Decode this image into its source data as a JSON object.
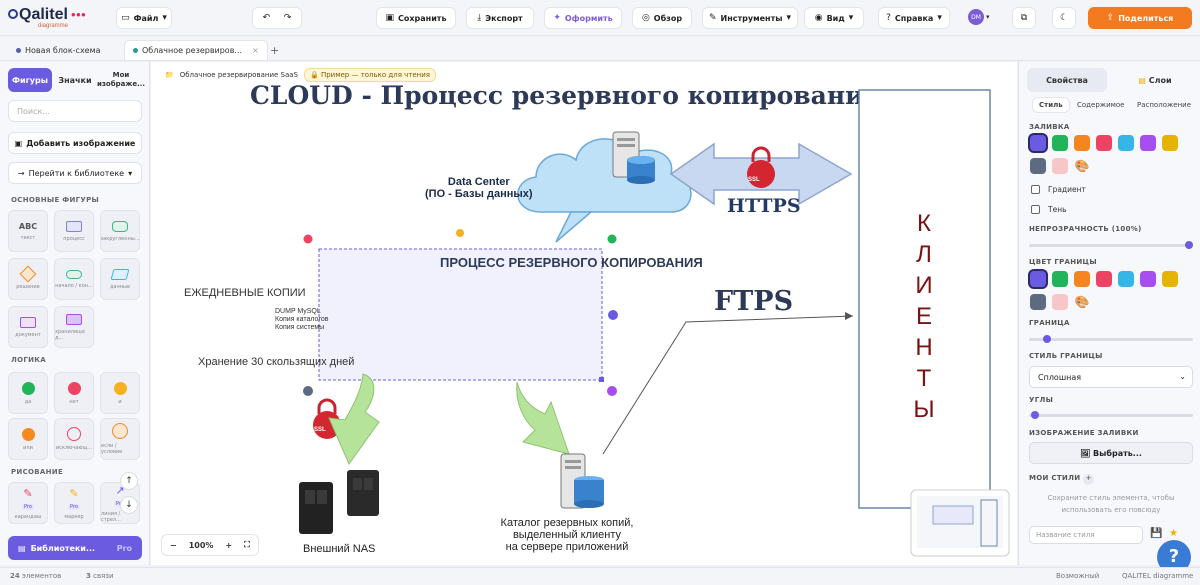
{
  "app": {
    "brand": "Qalitel",
    "brand_sub": "diagramme"
  },
  "toolbar": {
    "file": "Файл",
    "save": "Сохранить",
    "export": "Экспорт",
    "format": "Оформить",
    "overview": "Обзор",
    "tools": "Инструменты",
    "view": "Вид",
    "help": "Справка",
    "share": "Поделиться",
    "user_initials": "DM"
  },
  "tabs": [
    {
      "label": "Новая блок-схема"
    },
    {
      "label": "Облачное резервиров..."
    }
  ],
  "left": {
    "tabs": [
      "Фигуры",
      "Значки",
      "Мои изображе..."
    ],
    "search_placeholder": "Поиск...",
    "add_image": "Добавить изображение",
    "goto_library": "Перейти к библиотеке",
    "sections": {
      "basic": "ОСНОВНЫЕ ФИГУРЫ",
      "logic": "ЛОГИКА",
      "draw": "РИСОВАНИЕ"
    },
    "basic_shapes": [
      "текст",
      "процесс",
      "закругленны...",
      "решение",
      "начало / кон...",
      "данные",
      "документ",
      "хранилище д..."
    ],
    "logic_shapes": [
      "да",
      "нет",
      "и",
      "или",
      "исключающ...",
      "если / условие"
    ],
    "draw_shapes": [
      "карандаш",
      "маркер",
      "линия / стрел..."
    ],
    "draw_badges": [
      "Pro",
      "Pro",
      "Pro"
    ],
    "library_button": "Библиотеки...",
    "library_badge": "Pro"
  },
  "canvas": {
    "breadcrumb": "Облачное резервирование SaaS",
    "readonly_pill": "Пример — только для чтения",
    "title": "CLOUD - Процесс резервного копирования",
    "datacenter_1": "Data Center",
    "datacenter_2": "(ПО - Базы данных)",
    "https": "HTTPS",
    "ftps": "FTPS",
    "ssl": "SSL",
    "process_title": "ПРОЦЕСС РЕЗЕРВНОГО КОПИРОВАНИЯ",
    "daily": "ЕЖЕДНЕВНЫЕ КОПИИ",
    "dump_lines": [
      "DUMP MySQL",
      "Копия каталогов",
      "Копия системы"
    ],
    "retention": "Хранение 30 скользящих дней",
    "clients_letters": [
      "К",
      "Л",
      "И",
      "Е",
      "Н",
      "Т",
      "Ы"
    ],
    "catalog_lines": [
      "Каталог резервных копий,",
      "выделенный клиенту",
      "на сервере приложений"
    ],
    "nas": "Внешний NAS",
    "zoom": "100%"
  },
  "right": {
    "tabs": [
      "Свойства",
      "Слои"
    ],
    "subtabs": [
      "Стиль",
      "Содержимое",
      "Расположение"
    ],
    "fill_label": "ЗАЛИВКА",
    "gradient": "Градиент",
    "shadow": "Тень",
    "opacity_label": "НЕПРОЗРАЧНОСТЬ (100%)",
    "opacity": 1.0,
    "border_color_label": "ЦВЕТ ГРАНИЦЫ",
    "border_label": "ГРАНИЦА",
    "border_style_label": "СТИЛЬ ГРАНИЦЫ",
    "border_style": "Сплошная",
    "corners_label": "УГЛЫ",
    "fill_image_label": "ИЗОБРАЖЕНИЕ ЗАЛИВКИ",
    "choose": "Выбрать...",
    "my_styles": "МОИ СТИЛИ",
    "my_styles_hint_1": "Сохраните стиль элемента, чтобы",
    "my_styles_hint_2": "использовать его повсюду",
    "style_name_placeholder": "Название стиля",
    "swatches": [
      "#6b5be0",
      "#22b45a",
      "#f5861f",
      "#ee4463",
      "#36b6e8",
      "#a64ef0",
      "#e6b400",
      "#5c6a82",
      "#f7c6c6"
    ]
  },
  "status": {
    "items_count": "24",
    "items_label": "элементов",
    "selected_count": "3",
    "selected_label": "связи",
    "right_1": "Возможный",
    "right_2": "QALITEL diagramme"
  }
}
